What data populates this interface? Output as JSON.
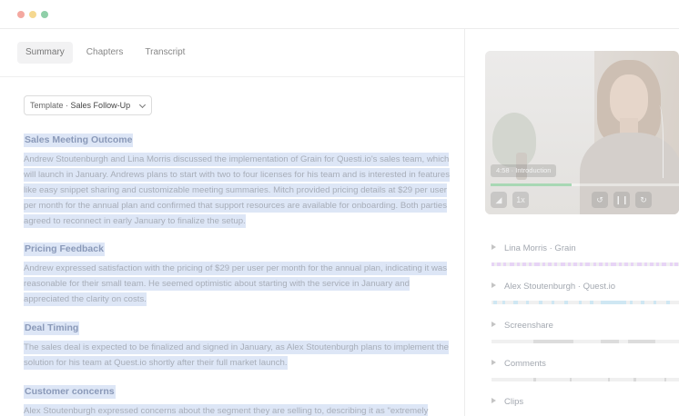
{
  "window": {
    "controls": [
      "close",
      "minimize",
      "maximize"
    ]
  },
  "tabs": [
    {
      "label": "Summary",
      "active": true
    },
    {
      "label": "Chapters",
      "active": false
    },
    {
      "label": "Transcript",
      "active": false
    }
  ],
  "template": {
    "prefix": "Template ·",
    "value": "Sales Follow-Up"
  },
  "sections": [
    {
      "title": "Sales Meeting Outcome",
      "body": "Andrew Stoutenburgh and Lina Morris discussed the implementation of Grain for Questi.io's sales team, which will launch in January. Andrews plans to start with two to four licenses for his team and is interested in features like easy snippet sharing and customizable meeting summaries. Mitch provided pricing details at $29 per user per month for the annual plan and confirmed that support resources are available for onboarding. Both parties agreed to reconnect in early January to finalize the setup."
    },
    {
      "title": "Pricing Feedback",
      "body": "Andrew expressed satisfaction with the pricing of $29 per user per month for the annual plan, indicating it was reasonable for their small team. He seemed optimistic about starting with the service in January and appreciated the clarity on costs."
    },
    {
      "title": "Deal Timing",
      "body": "The sales deal is expected to be finalized and signed in January, as Alex Stoutenburgh plans to implement the solution for his team at Quest.io shortly after their full market launch."
    },
    {
      "title": "Customer concerns",
      "body": "Alex Stoutenburgh expressed concerns about the segment they are selling to, describing it as \"extremely"
    }
  ],
  "video": {
    "timestamp": "4:58 · Introduction",
    "progress": 0.43,
    "controls": {
      "volume": "volume-icon",
      "speed": "1x",
      "rewind": "rewind-icon",
      "pause": "pause-icon",
      "forward": "forward-icon"
    }
  },
  "tracks": [
    {
      "label": "Lina Morris · Grain",
      "color": "#e7d4f6"
    },
    {
      "label": "Alex Stoutenburgh · Quest.io",
      "color": "#cfe7f3"
    },
    {
      "label": "Screenshare",
      "color": "#dcdcdc"
    },
    {
      "label": "Comments",
      "color": "#d9d9d9"
    },
    {
      "label": "Clips",
      "color": "#dcdcdc"
    }
  ],
  "colors": {
    "accent_highlight": "#dde6f6",
    "progress": "#a8d8b4"
  }
}
